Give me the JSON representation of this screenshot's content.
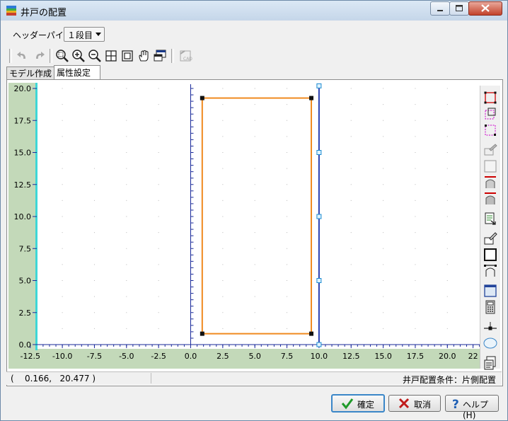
{
  "window": {
    "title": "井戸の配置"
  },
  "header": {
    "label": "ヘッダーパイプ",
    "select_value": "１段目"
  },
  "tabs": [
    {
      "label": "モデル作成"
    },
    {
      "label": "属性設定"
    }
  ],
  "toolbar_icons": [
    "undo-icon",
    "redo-icon",
    "zoom-area-icon",
    "zoom-in-icon",
    "zoom-out-icon",
    "fit-all-icon",
    "fit-selection-icon",
    "pan-hand-icon",
    "window-view-icon",
    "cad-import-icon"
  ],
  "right_toolbar_icons": [
    "rect-select-icon",
    "rect-select-dashed-icon",
    "rect-select-pink-icon",
    "edit-pencil-icon",
    "blank-rect-icon",
    "arch-red-icon",
    "arch-gray-icon",
    "export-sheet-icon",
    "edit-shape-icon",
    "big-rect-icon",
    "arch-outline-icon",
    "panel-view-icon",
    "calculator-icon",
    "insert-point-icon",
    "ellipse-icon",
    "report-icon"
  ],
  "colors": {
    "axis_strip": "#c3d9b9",
    "cyan_line": "#3ed7d7",
    "rect": "#f08a1f",
    "vline": "#2a3fb0",
    "grid_dot": "#b8b8b8"
  },
  "chart_data": {
    "type": "scatter",
    "x_ticks": [
      "-12.5",
      "-10.0",
      "-7.5",
      "-5.0",
      "-2.5",
      "0.0",
      "2.5",
      "5.0",
      "7.5",
      "10.0",
      "12.5",
      "15.0",
      "17.5",
      "20.0",
      "22"
    ],
    "y_ticks": [
      "20.0",
      "17.5",
      "15.0",
      "12.5",
      "10.0",
      "7.5",
      "5.0",
      "2.5",
      "0.0"
    ],
    "xlim": [
      -12.5,
      22.5
    ],
    "ylim": [
      0,
      20.5
    ],
    "rectangle": {
      "x1": 0.9,
      "y1": 0.85,
      "x2": 9.4,
      "y2": 19.25
    },
    "vertical_line": {
      "x": 10.0,
      "y1": 0,
      "y2": 20.2,
      "points_y": [
        0,
        5,
        10,
        15,
        20.2
      ]
    }
  },
  "status": {
    "coord": "(    0.166,   20.477 )",
    "condition": "井戸配置条件：片側配置"
  },
  "buttons": {
    "ok": "確定",
    "cancel": "取消",
    "help": "ヘルプ(H)"
  }
}
